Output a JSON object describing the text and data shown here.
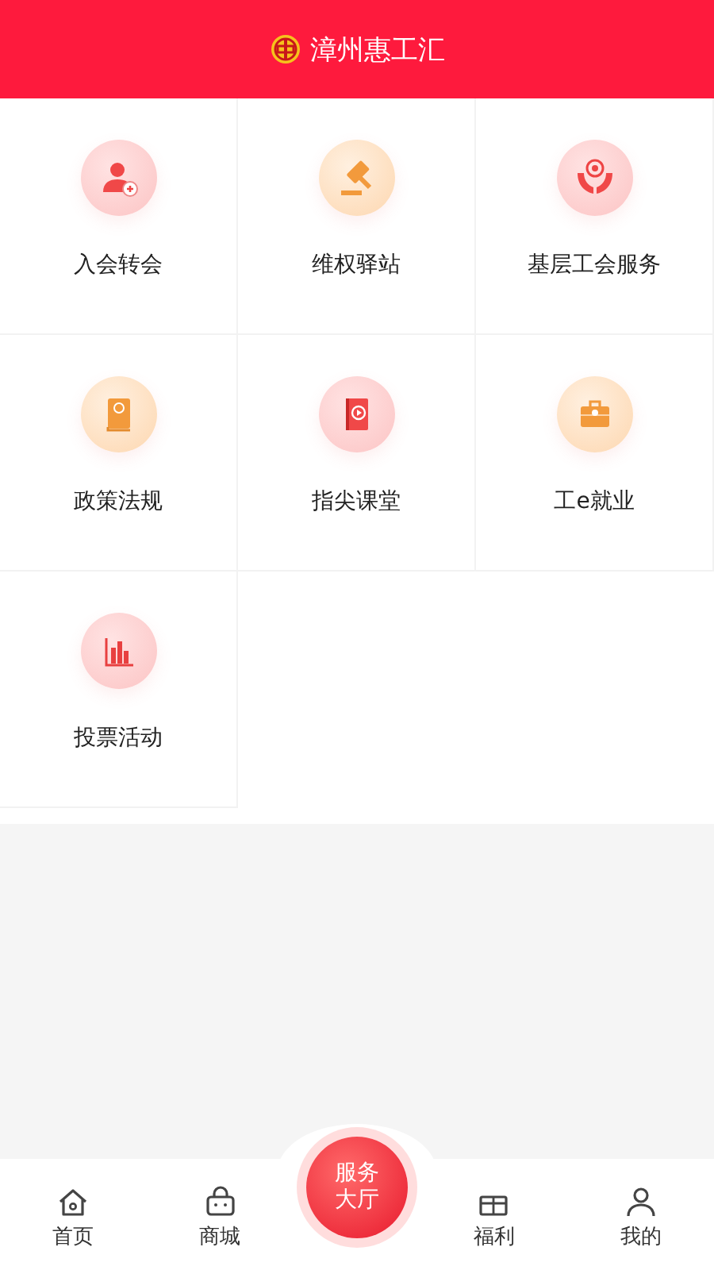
{
  "header": {
    "title": "漳州惠工汇"
  },
  "services": [
    {
      "label": "入会转会"
    },
    {
      "label": "维权驿站"
    },
    {
      "label": "基层工会服务"
    },
    {
      "label": "政策法规"
    },
    {
      "label": "指尖课堂"
    },
    {
      "label": "工e就业"
    },
    {
      "label": "投票活动"
    }
  ],
  "tab_bar": [
    {
      "label": "首页",
      "kind": "tab",
      "selected": false
    },
    {
      "label": "商城",
      "kind": "tab",
      "selected": false
    },
    {
      "label": "服务大厅",
      "kind": "center",
      "selected": true
    },
    {
      "label": "福利",
      "kind": "tab",
      "selected": false
    },
    {
      "label": "我的",
      "kind": "tab",
      "selected": false
    }
  ]
}
